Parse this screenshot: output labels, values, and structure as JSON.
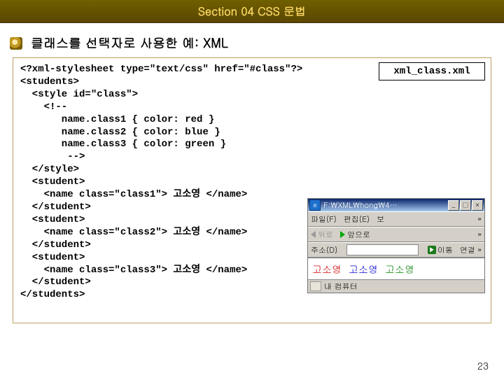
{
  "section": {
    "title": "Section 04 CSS 문법"
  },
  "subtitle": {
    "text": "클래스를 선택자로 사용한 예: XML"
  },
  "code": {
    "filename": "xml_class.xml",
    "text": "<?xml-stylesheet type=\"text/css\" href=\"#class\"?>\n<students>\n  <style id=\"class\">\n    <!--\n       name.class1 { color: red }\n       name.class2 { color: blue }\n       name.class3 { color: green }\n        -->\n  </style>\n  <student>\n    <name class=\"class1\"> 고소영 </name>\n  </student>\n  <student>\n    <name class=\"class2\"> 고소영 </name>\n  </student>\n  <student>\n    <name class=\"class3\"> 고소영 </name>\n  </student>\n</students>"
  },
  "browser": {
    "title": "F:\\XML\\hong\\4…",
    "win": {
      "min": "_",
      "max": "□",
      "close": "×"
    },
    "menu": {
      "file": "파일(F)",
      "edit": "편집(E)",
      "view": "보",
      "more": "»"
    },
    "nav": {
      "back": "뒤로",
      "forward": "앞으로",
      "more": "»"
    },
    "addr": {
      "label": "주소(D)",
      "go": "이동",
      "links": "연결 »"
    },
    "content": {
      "n1": "고소영",
      "n2": "고소영",
      "n3": "고소영"
    },
    "status": {
      "text": "내 컴퓨터"
    }
  },
  "page_number": "23"
}
